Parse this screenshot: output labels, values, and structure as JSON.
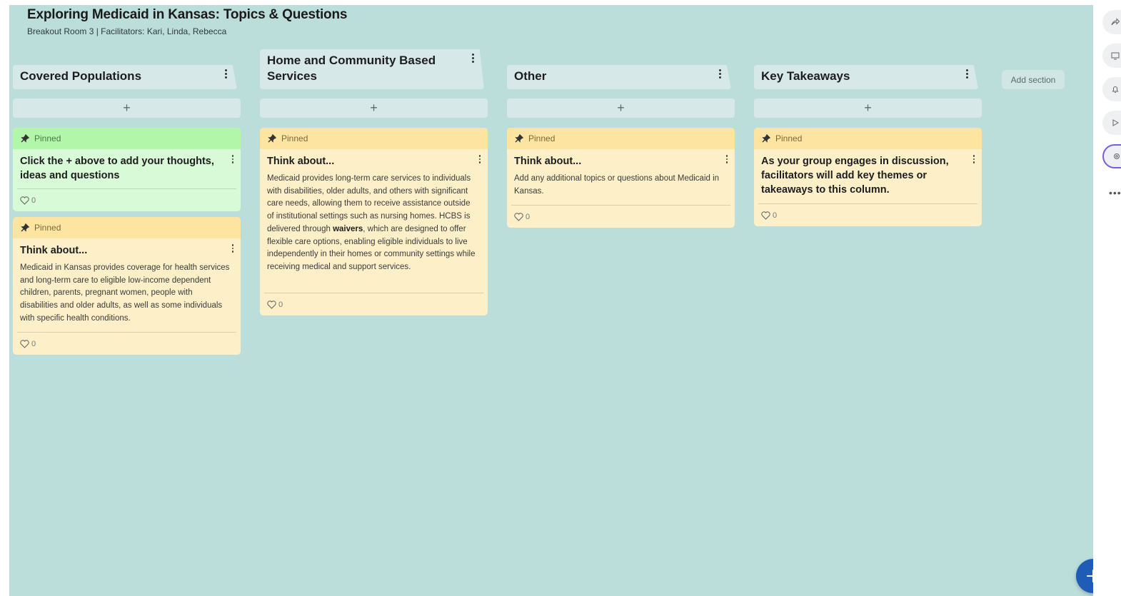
{
  "board": {
    "title": "Exploring Medicaid in Kansas: Topics & Questions",
    "subtitle": "Breakout Room 3 | Facilitators: Kari, Linda, Rebecca",
    "background": "#bcdedb",
    "add_section_label": "Add section",
    "add_post_symbol": "+"
  },
  "columns": [
    {
      "title": "Covered Populations",
      "cards": [
        {
          "pinned_label": "Pinned",
          "color": "#d9fad6",
          "title": "Click the + above to add your thoughts, ideas and questions",
          "body": "",
          "likes": "0"
        },
        {
          "pinned_label": "Pinned",
          "color": "#fdf0c9",
          "title": "Think about...",
          "body": "Medicaid in Kansas provides coverage for health services and long-term care to eligible low-income dependent children, parents, pregnant women, people with disabilities and older adults, as well as some individuals with specific health conditions.",
          "likes": "0"
        }
      ]
    },
    {
      "title": "Home and Community Based Services",
      "cards": [
        {
          "pinned_label": "Pinned",
          "color": "#fdf0c9",
          "title": "Think about...",
          "body_before": "Medicaid provides long-term care services to individuals with disabilities, older adults, and others with significant care needs, allowing them to receive assistance outside of institutional settings such as nursing homes. HCBS is delivered through ",
          "body_bold": "waivers",
          "body_after": ", which are designed to offer flexible care options, enabling eligible individuals to live independently in their homes or community settings while receiving medical and support services.",
          "likes": "0"
        }
      ]
    },
    {
      "title": "Other",
      "cards": [
        {
          "pinned_label": "Pinned",
          "color": "#fdf0c9",
          "title": "Think about...",
          "body": "Add any additional topics or questions about Medicaid in Kansas.",
          "likes": "0"
        }
      ]
    },
    {
      "title": "Key Takeaways",
      "cards": [
        {
          "pinned_label": "Pinned",
          "color": "#fdf0c9",
          "title": "As your group engages in discussion, facilitators will add key themes or takeaways to this column.",
          "body": "",
          "likes": "0"
        }
      ]
    }
  ],
  "rail": {
    "icons": [
      "share-icon",
      "slideshow-icon",
      "bell-icon",
      "play-icon",
      "settings-icon"
    ],
    "more_label": "•••",
    "active_accent": "#7b5ce0"
  },
  "fab": {
    "symbol": "+",
    "color": "#1f5cb8"
  }
}
